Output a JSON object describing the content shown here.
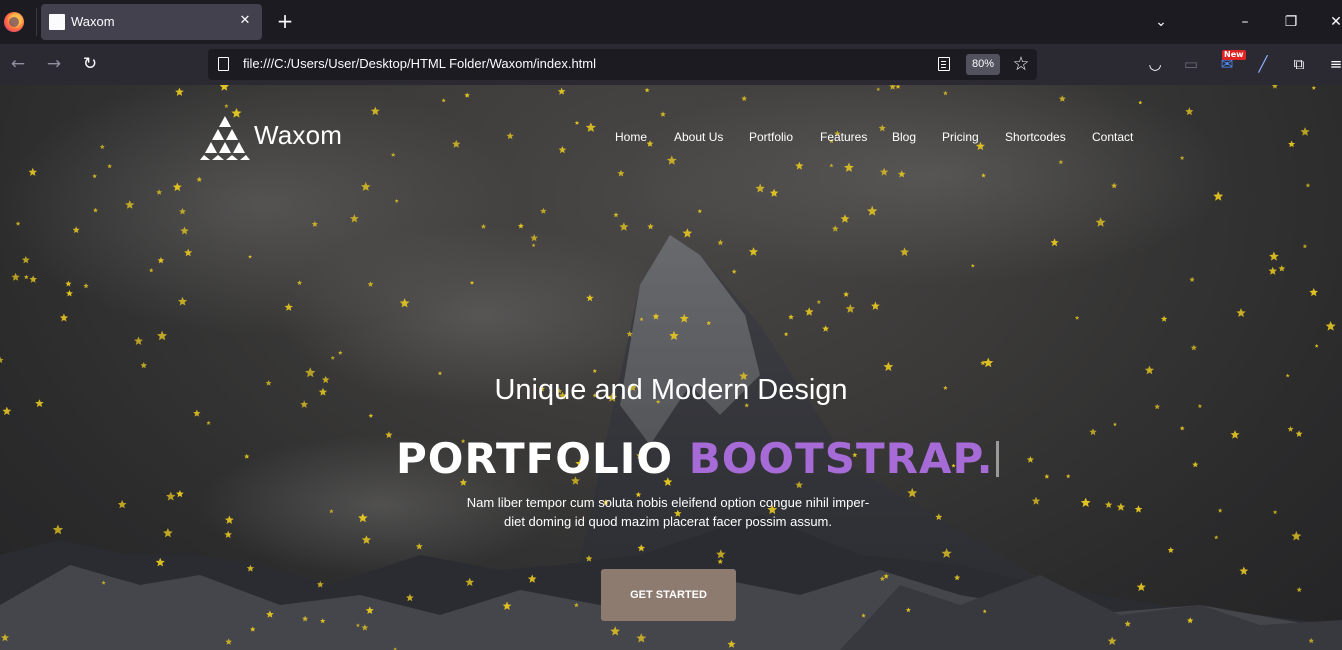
{
  "browser": {
    "tab": {
      "title": "Waxom"
    },
    "url": "file:///C:/Users/User/Desktop/HTML Folder/Waxom/index.html",
    "zoom": "80%",
    "badge": "New"
  },
  "site": {
    "logo_text": "Waxom",
    "nav": [
      "Home",
      "About Us",
      "Portfolio",
      "Features",
      "Blog",
      "Pricing",
      "Shortcodes",
      "Contact"
    ],
    "hero": {
      "subtitle": "Unique and Modern Design",
      "headline_main": "PORTFOLIO ",
      "headline_accent": "BOOTSTRAP.",
      "description_line1": "Nam liber tempor cum soluta nobis eleifend option congue nihil imper-",
      "description_line2": "diet doming id quod mazim placerat facer possim assum.",
      "cta": "GET STARTED"
    }
  },
  "colors": {
    "accent": "#a66bd6",
    "cta": "#8e7b70",
    "stars": "#e3c421"
  }
}
